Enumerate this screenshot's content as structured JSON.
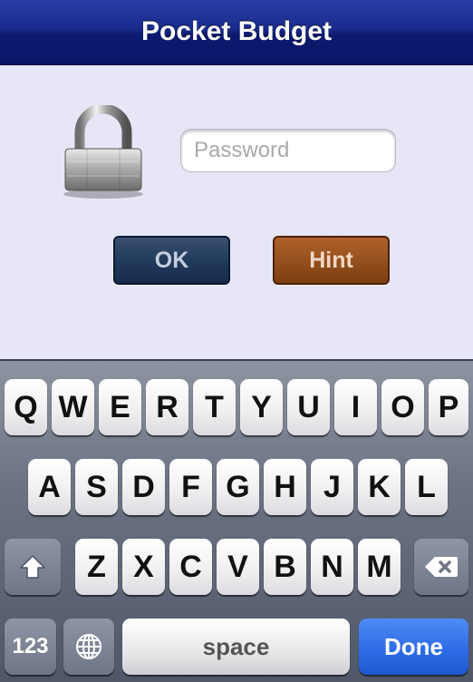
{
  "navbar": {
    "title": "Pocket Budget"
  },
  "login": {
    "password_placeholder": "Password",
    "ok_label": "OK",
    "hint_label": "Hint"
  },
  "keyboard": {
    "row1": [
      "Q",
      "W",
      "E",
      "R",
      "T",
      "Y",
      "U",
      "I",
      "O",
      "P"
    ],
    "row2": [
      "A",
      "S",
      "D",
      "F",
      "G",
      "H",
      "J",
      "K",
      "L"
    ],
    "row3": [
      "Z",
      "X",
      "C",
      "V",
      "B",
      "N",
      "M"
    ],
    "numbers_label": "123",
    "space_label": "space",
    "done_label": "Done"
  },
  "colors": {
    "navbar": "#1a2b8c",
    "background": "#e6e6f6",
    "ok_button": "#223a5c",
    "hint_button": "#96501e",
    "done_key": "#2e6de6"
  },
  "icons": {
    "lock": "padlock-icon",
    "shift": "shift-icon",
    "delete": "backspace-icon",
    "globe": "globe-icon"
  }
}
